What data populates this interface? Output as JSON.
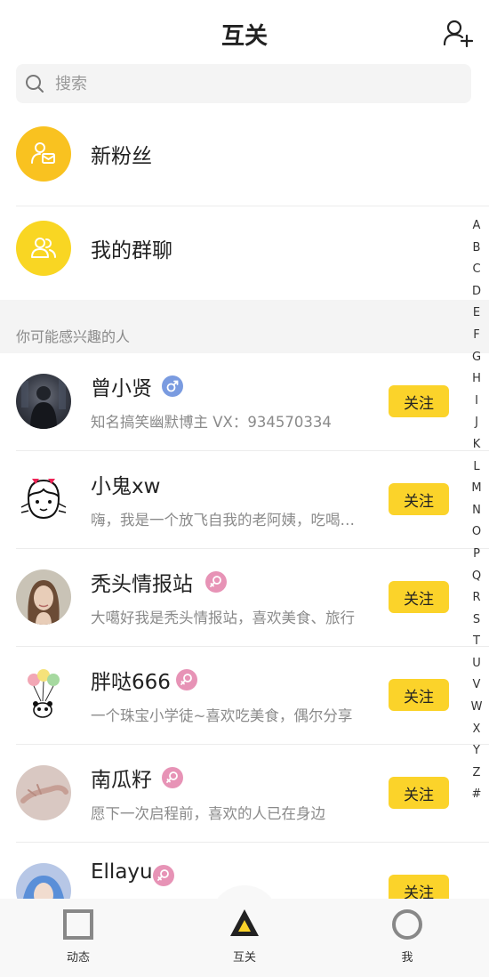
{
  "header": {
    "title": "互关"
  },
  "search": {
    "placeholder": "搜索"
  },
  "entries": [
    {
      "label": "新粉丝",
      "icon": "new-fans-icon"
    },
    {
      "label": "我的群聊",
      "icon": "group-chat-icon"
    }
  ],
  "section": {
    "title": "你可能感兴趣的人"
  },
  "suggestions": [
    {
      "name": "曾小贤",
      "gender": "male",
      "desc": "知名搞笑幽默博主   VX：934570334",
      "button": "关注"
    },
    {
      "name": "小鬼xw",
      "gender": "",
      "desc": "嗨，我是一个放飞自我的老阿姨，吃喝玩乐",
      "button": "关注"
    },
    {
      "name": "秃头情报站",
      "gender": "female",
      "desc": "大噶好我是秃头情报站，喜欢美食、旅行",
      "button": "关注"
    },
    {
      "name": "胖哒666",
      "gender": "female",
      "desc": "一个珠宝小学徒~喜欢吃美食，偶尔分享",
      "button": "关注"
    },
    {
      "name": "南瓜籽",
      "gender": "female",
      "desc": "愿下一次启程前，喜欢的人已在身边",
      "button": "关注"
    },
    {
      "name": "Ellayu",
      "gender": "female",
      "desc": "",
      "button": "关注"
    }
  ],
  "alphabet": [
    "A",
    "B",
    "C",
    "D",
    "E",
    "F",
    "G",
    "H",
    "I",
    "J",
    "K",
    "L",
    "M",
    "N",
    "O",
    "P",
    "Q",
    "R",
    "S",
    "T",
    "U",
    "V",
    "W",
    "X",
    "Y",
    "Z",
    "#"
  ],
  "nav": [
    {
      "label": "动态",
      "icon": "square-icon"
    },
    {
      "label": "互关",
      "icon": "triangle-icon"
    },
    {
      "label": "我",
      "icon": "circle-icon"
    }
  ],
  "colors": {
    "accent": "#fbd32a",
    "male": "#7a9be0",
    "female": "#e793b6"
  }
}
